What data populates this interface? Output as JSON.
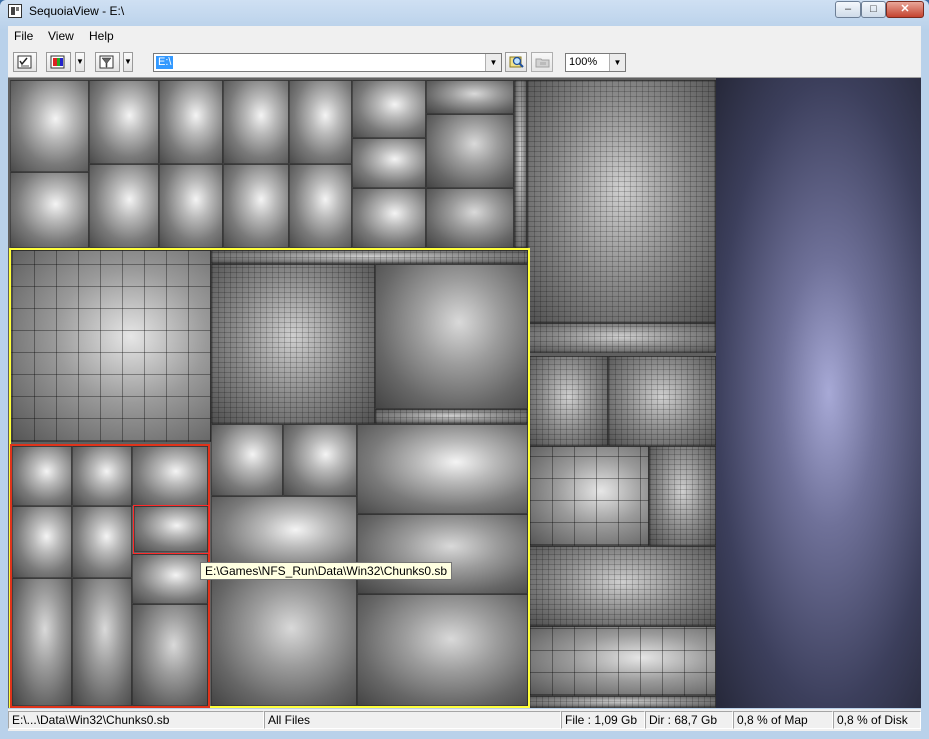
{
  "window": {
    "title": "SequoiaView - E:\\"
  },
  "titlebar_buttons": {
    "minimize": "–",
    "maximize": "□",
    "close": "✕"
  },
  "menu": [
    {
      "label": "File"
    },
    {
      "label": "View"
    },
    {
      "label": "Help"
    }
  ],
  "toolbar": {
    "path_value": "E:\\",
    "zoom_value": "100%",
    "icons": [
      "checklist-icon",
      "colors-icon",
      "filter-icon",
      "rescan-icon",
      "folder-up-icon"
    ]
  },
  "tooltip": {
    "text": "E:\\Games\\NFS_Run\\Data\\Win32\\Chunks0.sb"
  },
  "status": {
    "path": "E:\\...\\Data\\Win32\\Chunks0.sb",
    "filter": "All Files",
    "file_size": "File : 1,09 Gb",
    "dir_size": "Dir : 68,7 Gb",
    "pct_map": "0,8 % of Map",
    "pct_disk": "0,8 % of Disk"
  },
  "colors": {
    "highlight_dir": "#ffff3a",
    "highlight_subdir": "#e0331a",
    "highlight_file": "#ff2a2a",
    "free_space": "#6f7199"
  }
}
